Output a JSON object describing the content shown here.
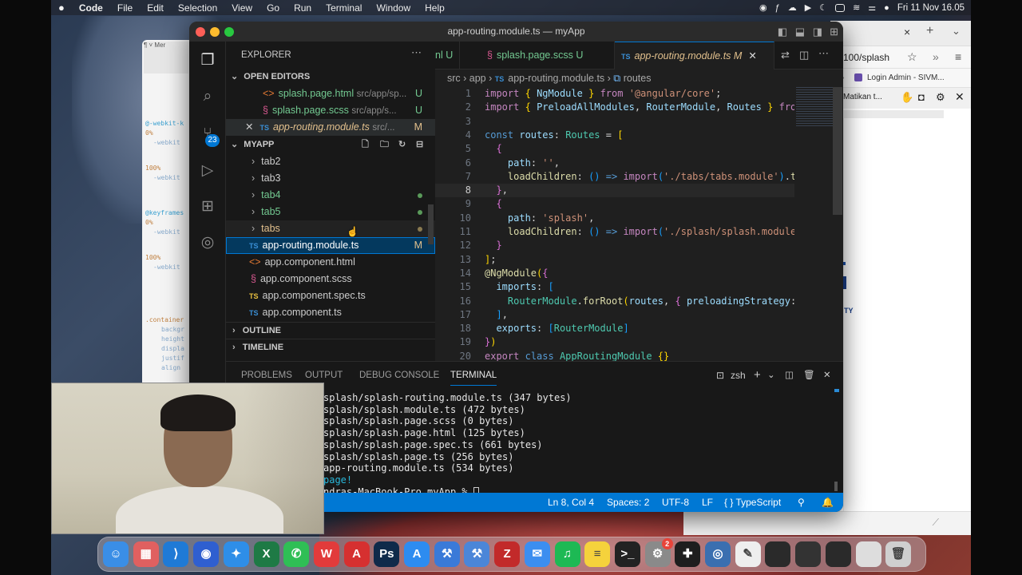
{
  "menubar": {
    "items": [
      "Code",
      "File",
      "Edit",
      "Selection",
      "View",
      "Go",
      "Run",
      "Terminal",
      "Window",
      "Help"
    ],
    "clock": "Fri 11 Nov  16.05"
  },
  "browser": {
    "tab_close": "×",
    "new_tab": "+",
    "address": "100/splash",
    "bookmark": "Login Admin - SIVM...",
    "tool_text": "Matikan t..."
  },
  "bgwin": {
    "lines": [
      "@-webkit-k",
      "0%",
      "-webkit",
      "100%",
      "-webkit",
      "@keyframes",
      "0%",
      "-webkit",
      "100%",
      "-webkit",
      ".container",
      "backgr",
      "height",
      "displa",
      "justif",
      "align"
    ]
  },
  "vscode": {
    "title": "app-routing.module.ts — myApp",
    "badge": "23",
    "sidebar": {
      "explorer_label": "EXPLORER",
      "open_editors_label": "OPEN EDITORS",
      "open_editors": [
        {
          "icon": "<>",
          "name": "splash.page.html",
          "path": "src/app/sp...",
          "status": "U"
        },
        {
          "icon": "§",
          "name": "splash.page.scss",
          "path": "src/app/s...",
          "status": "U"
        },
        {
          "icon": "TS",
          "name": "app-routing.module.ts",
          "path": "src/...",
          "status": "M"
        }
      ],
      "project_label": "MYAPP",
      "tree": [
        {
          "name": "tab2",
          "folder": true
        },
        {
          "name": "tab3",
          "folder": true
        },
        {
          "name": "tab4",
          "folder": true
        },
        {
          "name": "tab5",
          "folder": true
        },
        {
          "name": "tabs",
          "folder": true
        },
        {
          "name": "app-routing.module.ts",
          "icon": "TS",
          "status": "M"
        },
        {
          "name": "app.component.html",
          "icon": "<>"
        },
        {
          "name": "app.component.scss",
          "icon": "§"
        },
        {
          "name": "app.component.spec.ts",
          "icon": "TS"
        },
        {
          "name": "app.component.ts",
          "icon": "TS"
        }
      ],
      "outline_label": "OUTLINE",
      "timeline_label": "TIMELINE"
    },
    "tabs": [
      {
        "label": "nl",
        "status": "U"
      },
      {
        "label": "splash.page.scss",
        "status": "U"
      },
      {
        "label": "app-routing.module.ts",
        "status": "M"
      }
    ],
    "breadcrumb": [
      "src",
      "app",
      "app-routing.module.ts",
      "routes"
    ],
    "code_lines": [
      {
        "n": "1",
        "html": "<span class='kw'>import</span> <span class='br'>{</span> <span class='vr'>NgModule</span> <span class='br'>}</span> <span class='kw'>from</span> <span class='st'>'@angular/core'</span><span class='pl'>;</span>"
      },
      {
        "n": "2",
        "html": "<span class='kw'>import</span> <span class='br'>{</span> <span class='vr'>PreloadAllModules</span><span class='pl'>,</span> <span class='vr'>RouterModule</span><span class='pl'>,</span> <span class='vr'>Routes</span> <span class='br'>}</span> <span class='kw'>from</span>"
      },
      {
        "n": "3",
        "html": ""
      },
      {
        "n": "4",
        "html": "<span class='kb'>const</span> <span class='vr'>routes</span><span class='pl'>:</span> <span class='ty'>Routes</span> <span class='pl'>=</span> <span class='br'>[</span>"
      },
      {
        "n": "5",
        "html": "  <span class='br2'>{</span>"
      },
      {
        "n": "6",
        "html": "    <span class='vr'>path</span><span class='pl'>:</span> <span class='st'>''</span><span class='pl'>,</span>"
      },
      {
        "n": "7",
        "html": "    <span class='fn'>loadChildren</span><span class='pl'>:</span> <span class='br3'>()</span> <span class='kb'>=&gt;</span> <span class='kw'>import</span><span class='br3'>(</span><span class='st'>'./tabs/tabs.module'</span><span class='br3'>)</span><span class='pl'>.</span><span class='fn'>the</span>"
      },
      {
        "n": "8",
        "html": "  <span class='br2'>}</span><span class='pl'>,</span>"
      },
      {
        "n": "9",
        "html": "  <span class='br2'>{</span>"
      },
      {
        "n": "10",
        "html": "    <span class='vr'>path</span><span class='pl'>:</span> <span class='st'>'splash'</span><span class='pl'>,</span>"
      },
      {
        "n": "11",
        "html": "    <span class='fn'>loadChildren</span><span class='pl'>:</span> <span class='br3'>()</span> <span class='kb'>=&gt;</span> <span class='kw'>import</span><span class='br3'>(</span><span class='st'>'./splash/splash.module'</span>"
      },
      {
        "n": "12",
        "html": "  <span class='br2'>}</span>"
      },
      {
        "n": "13",
        "html": "<span class='br'>]</span><span class='pl'>;</span>"
      },
      {
        "n": "14",
        "html": "<span class='fn'>@NgModule</span><span class='br'>(</span><span class='br2'>{</span>"
      },
      {
        "n": "15",
        "html": "  <span class='vr'>imports</span><span class='pl'>:</span> <span class='br3'>[</span>"
      },
      {
        "n": "16",
        "html": "    <span class='ty'>RouterModule</span><span class='pl'>.</span><span class='fn'>forRoot</span><span class='br'>(</span><span class='vr'>routes</span><span class='pl'>,</span> <span class='br2'>{</span> <span class='vr'>preloadingStrategy</span><span class='pl'>:</span>"
      },
      {
        "n": "17",
        "html": "  <span class='br3'>]</span><span class='pl'>,</span>"
      },
      {
        "n": "18",
        "html": "  <span class='vr'>exports</span><span class='pl'>:</span> <span class='br3'>[</span><span class='ty'>RouterModule</span><span class='br3'>]</span>"
      },
      {
        "n": "19",
        "html": "<span class='br2'>}</span><span class='br'>)</span>"
      },
      {
        "n": "20",
        "html": "<span class='kw'>export</span> <span class='kb'>class</span> <span class='ty'>AppRoutingModule</span> <span class='br'>{}</span>"
      }
    ],
    "panel": {
      "tabs": [
        "PROBLEMS",
        "OUTPUT",
        "DEBUG CONSOLE",
        "TERMINAL"
      ],
      "shell": "zsh",
      "terminal_lines": [
        "splash/splash-routing.module.ts (347 bytes)",
        "splash/splash.module.ts (472 bytes)",
        "splash/splash.page.scss (0 bytes)",
        "splash/splash.page.html (125 bytes)",
        "splash/splash.page.spec.ts (661 bytes)",
        "splash/splash.page.ts (256 bytes)",
        "app-routing.module.ts (534 bytes)",
        "page!",
        "ndras-MacBook-Pro myApp % "
      ]
    },
    "status": {
      "position": "Ln 8, Col 4",
      "spaces": "Spaces: 2",
      "encoding": "UTF-8",
      "eol": "LF",
      "language": "{ } TypeScript"
    }
  },
  "dock": {
    "apps": [
      {
        "name": "finder",
        "glyph": "☺",
        "color": "#3a8ee6"
      },
      {
        "name": "launchpad",
        "glyph": "▦",
        "color": "#e06060"
      },
      {
        "name": "vscode",
        "glyph": "⟩",
        "color": "#1f7ad6"
      },
      {
        "name": "firefox",
        "glyph": "◉",
        "color": "#2f5fd0"
      },
      {
        "name": "safari",
        "glyph": "✦",
        "color": "#2e8ee8"
      },
      {
        "name": "excel",
        "glyph": "X",
        "color": "#1e7a45"
      },
      {
        "name": "whatsapp",
        "glyph": "✆",
        "color": "#2fbf55"
      },
      {
        "name": "wps",
        "glyph": "W",
        "color": "#e23b3b"
      },
      {
        "name": "acrobat",
        "glyph": "A",
        "color": "#d63030"
      },
      {
        "name": "photoshop",
        "glyph": "Ps",
        "color": "#0f2a4a"
      },
      {
        "name": "app-store",
        "glyph": "A",
        "color": "#2d8cf0"
      },
      {
        "name": "xcode",
        "glyph": "⚒",
        "color": "#3a7ad8"
      },
      {
        "name": "xcode-2",
        "glyph": "⚒",
        "color": "#4b86d8"
      },
      {
        "name": "filezilla",
        "glyph": "Z",
        "color": "#c22a2a"
      },
      {
        "name": "mail",
        "glyph": "✉",
        "color": "#3c8ef0"
      },
      {
        "name": "spotify",
        "glyph": "♫",
        "color": "#1db954"
      },
      {
        "name": "notes",
        "glyph": "≡",
        "color": "#f5d23c"
      },
      {
        "name": "terminal",
        "glyph": ">_",
        "color": "#222222"
      },
      {
        "name": "system-settings",
        "glyph": "⚙",
        "color": "#8a8a8a"
      },
      {
        "name": "figma",
        "glyph": "✚",
        "color": "#1e1e1e"
      },
      {
        "name": "proxyman",
        "glyph": "◎",
        "color": "#3a6fb0"
      },
      {
        "name": "textedit",
        "glyph": "✎",
        "color": "#eeeeee"
      },
      {
        "name": "window-1",
        "glyph": "",
        "color": "#2a2a2a"
      },
      {
        "name": "window-2",
        "glyph": "",
        "color": "#333333"
      },
      {
        "name": "window-3",
        "glyph": "",
        "color": "#2a2a2a"
      },
      {
        "name": "window-4",
        "glyph": "",
        "color": "#dddddd"
      },
      {
        "name": "trash",
        "glyph": "🗑",
        "color": "#cfcfcf"
      }
    ],
    "settings_badge": "2"
  }
}
